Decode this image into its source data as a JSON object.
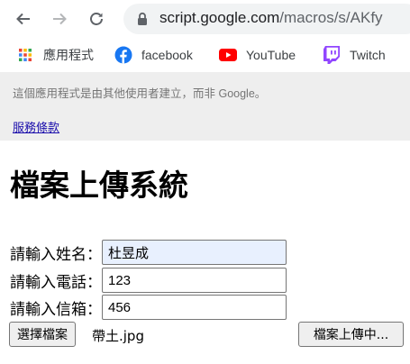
{
  "browser": {
    "url_host": "script.google.com",
    "url_path": "/macros/s/AKfy"
  },
  "bookmarks": [
    {
      "label": "應用程式",
      "icon": "apps-grid-icon"
    },
    {
      "label": "facebook",
      "icon": "facebook-icon"
    },
    {
      "label": "YouTube",
      "icon": "youtube-icon"
    },
    {
      "label": "Twitch",
      "icon": "twitch-icon"
    }
  ],
  "banner": {
    "notice": "這個應用程式是由其他使用者建立，而非 Google。",
    "terms_link": "服務條款"
  },
  "form": {
    "title": "檔案上傳系統",
    "name_label": "請輸入姓名：",
    "name_value": "杜昱成",
    "phone_label": "請輸入電話：",
    "phone_value": "123",
    "email_label": "請輸入信箱：",
    "email_value": "456",
    "choose_file_button": "選擇檔案",
    "chosen_file": "帶土.jpg",
    "upload_button": "檔案上傳中..."
  },
  "colors": {
    "autofill": "#e8f0fe",
    "link": "#1a0dab",
    "youtube": "#ff0000",
    "twitch": "#9146ff",
    "facebook": "#1877f2"
  }
}
